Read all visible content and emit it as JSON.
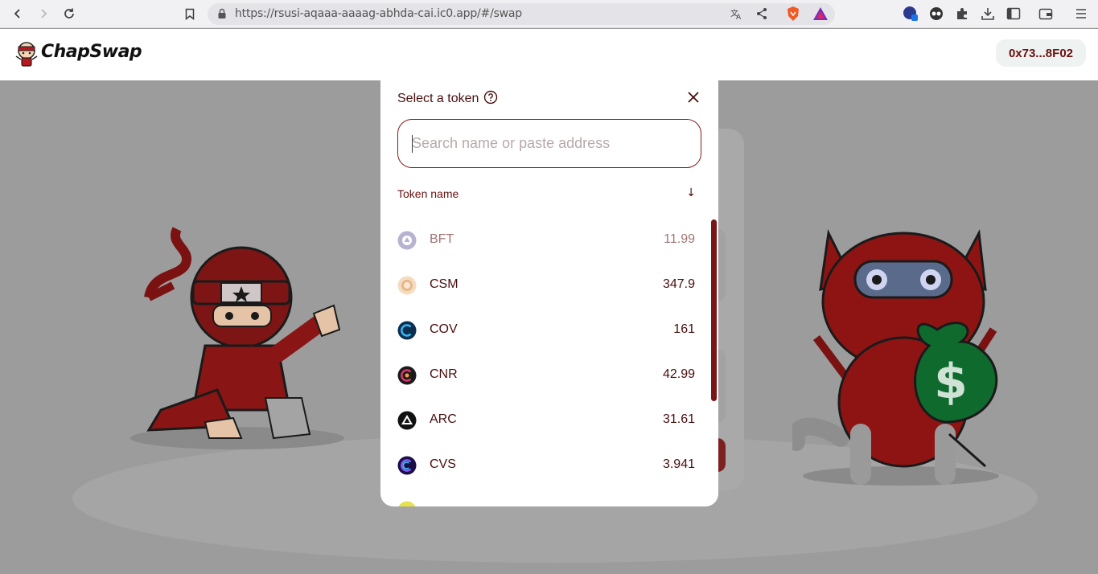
{
  "browser": {
    "url": "https://rsusi-aqaaa-aaaag-abhda-cai.ic0.app/#/swap"
  },
  "header": {
    "brand": "ChapSwap",
    "wallet_address": "0x73...8F02"
  },
  "modal": {
    "title": "Select a token",
    "search_placeholder": "Search name or paste address",
    "search_value": "",
    "list_header": "Token name",
    "sort_indicator": "↓",
    "tokens": [
      {
        "symbol": "BFT",
        "balance": "11.99",
        "icon": "bft-token-icon",
        "color": "#8a7fb5"
      },
      {
        "symbol": "CSM",
        "balance": "347.9",
        "icon": "csm-token-icon",
        "color": "#e7b98a"
      },
      {
        "symbol": "COV",
        "balance": "161",
        "icon": "cov-token-icon",
        "color": "#1f8ad1"
      },
      {
        "symbol": "CNR",
        "balance": "42.99",
        "icon": "cnr-token-icon",
        "color": "#e0356d"
      },
      {
        "symbol": "ARC",
        "balance": "31.61",
        "icon": "arc-token-icon",
        "color": "#111111"
      },
      {
        "symbol": "CVS",
        "balance": "3.941",
        "icon": "cvs-token-icon",
        "color": "#5a2bd6"
      }
    ]
  },
  "colors": {
    "accent": "#6b1010",
    "text": "#4a0d0d",
    "overlay": "#9c9c9c"
  }
}
